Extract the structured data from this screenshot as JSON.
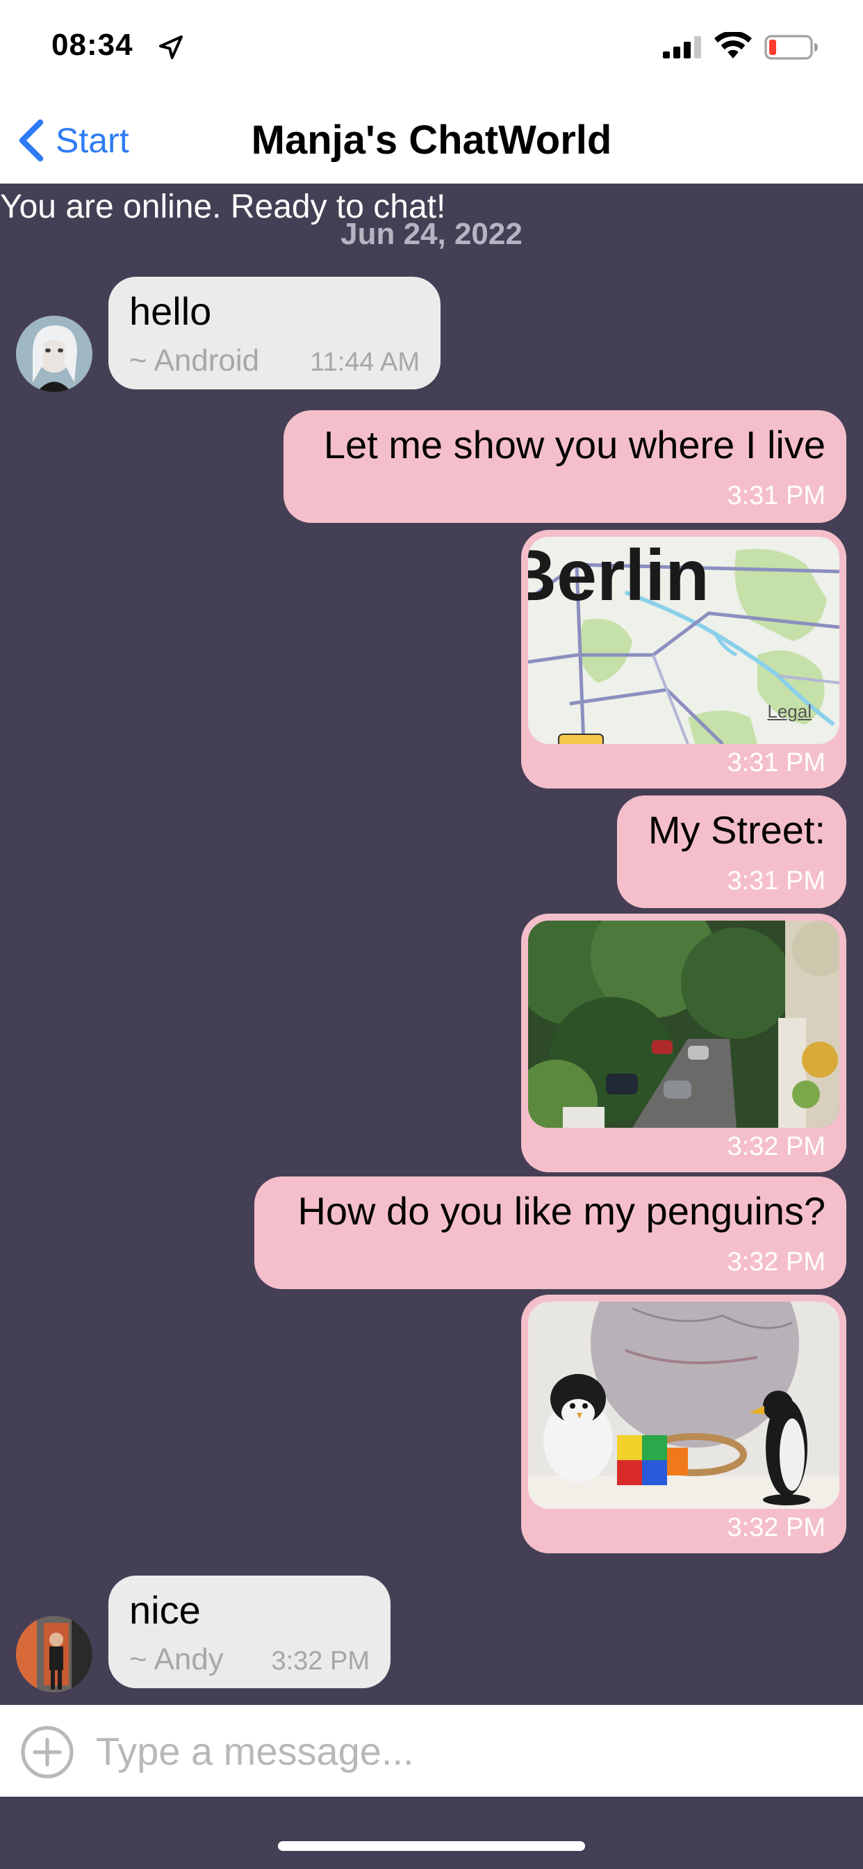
{
  "status_bar": {
    "time": "08:34",
    "location_icon": "location-arrow-icon",
    "signal_icon": "cellular-signal-icon",
    "wifi_icon": "wifi-icon",
    "battery_icon": "battery-low-icon",
    "battery_color": "#ff3b30"
  },
  "navbar": {
    "back_label": "Start",
    "title": "Manja's ChatWorld",
    "accent": "#2f7bf6"
  },
  "chat": {
    "status_text": "You are online. Ready to chat!",
    "date": "Jun 24, 2022",
    "background": "#453f55",
    "messages": [
      {
        "direction": "incoming",
        "text": "hello",
        "sender": "~ Android",
        "time": "11:44 AM"
      },
      {
        "direction": "outgoing",
        "text": "Let me show you where I live",
        "time": "3:31 PM"
      },
      {
        "direction": "outgoing",
        "type": "map",
        "map_label": "Berlin",
        "legal_label": "Legal",
        "time": "3:31 PM"
      },
      {
        "direction": "outgoing",
        "text": "My Street:",
        "time": "3:31 PM"
      },
      {
        "direction": "outgoing",
        "type": "photo",
        "photo_subject": "street-view-photo",
        "time": "3:32 PM"
      },
      {
        "direction": "outgoing",
        "text": "How do you like my penguins?",
        "time": "3:32 PM"
      },
      {
        "direction": "outgoing",
        "type": "photo",
        "photo_subject": "penguins-globe-photo",
        "time": "3:32 PM"
      },
      {
        "direction": "incoming",
        "text": "nice",
        "sender": "~ Andy",
        "time": "3:32 PM"
      }
    ]
  },
  "composer": {
    "placeholder": "Type a message...",
    "add_icon": "plus-circle-icon"
  },
  "colors": {
    "incoming_bubble": "#ebebeb",
    "outgoing_bubble": "#f4bfcb"
  }
}
